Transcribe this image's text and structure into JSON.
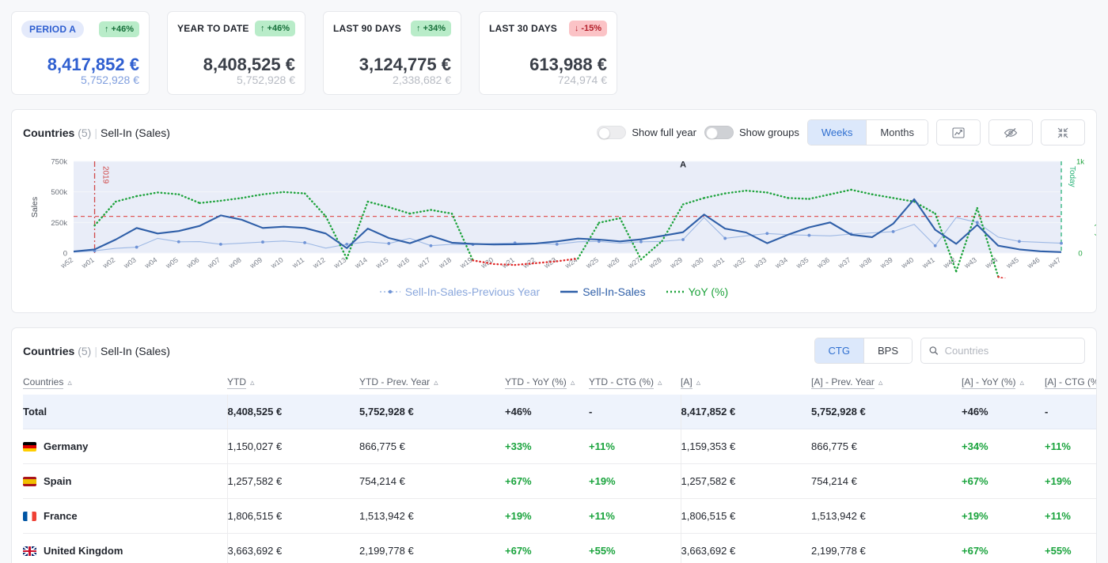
{
  "kpi_cards": [
    {
      "label": "PERIOD A",
      "accent": true,
      "delta": "+46%",
      "direction": "up",
      "value": "8,417,852 €",
      "prev": "5,752,928 €"
    },
    {
      "label": "YEAR TO DATE",
      "accent": false,
      "delta": "+46%",
      "direction": "up",
      "value": "8,408,525 €",
      "prev": "5,752,928 €"
    },
    {
      "label": "LAST 90 DAYS",
      "accent": false,
      "delta": "+34%",
      "direction": "up",
      "value": "3,124,775 €",
      "prev": "2,338,682 €"
    },
    {
      "label": "LAST 30 DAYS",
      "accent": false,
      "delta": "-15%",
      "direction": "down",
      "value": "613,988 €",
      "prev": "724,974 €"
    }
  ],
  "chart_panel": {
    "title_main": "Countries",
    "title_count": "(5)",
    "title_sub": "Sell-In (Sales)",
    "toggles": [
      {
        "label": "Show full year",
        "on": false,
        "dim": false
      },
      {
        "label": "Show groups",
        "on": false,
        "dim": true
      }
    ],
    "granularity": {
      "options": [
        "Weeks",
        "Months"
      ],
      "selected": "Weeks"
    },
    "icon_buttons": [
      "trend-chart-icon",
      "eye-off-icon",
      "collapse-icon"
    ],
    "legend": [
      {
        "name": "Sell-In-Sales-Previous Year",
        "color": "#8aa7dc",
        "style": "dotted-marker"
      },
      {
        "name": "Sell-In-Sales",
        "color": "#2f5fa8",
        "style": "solid"
      },
      {
        "name": "YoY (%)",
        "color": "#1ea33c",
        "style": "dotted"
      }
    ]
  },
  "chart_data": {
    "type": "line",
    "title": "Countries (5) | Sell-In (Sales)",
    "xlabel": "",
    "ylabel": "Sales",
    "y2label": "YoY (%)",
    "ylim": [
      0,
      750000
    ],
    "yticks": [
      0,
      250000,
      500000,
      750000
    ],
    "ytick_labels": [
      "0",
      "250k",
      "500k",
      "750k"
    ],
    "y2lim": [
      0,
      1000
    ],
    "y2ticks": [
      0,
      1000
    ],
    "y2tick_labels": [
      "0",
      "1k"
    ],
    "grid": true,
    "legend_position": "bottom-center",
    "annotations": [
      {
        "text": "2019",
        "type": "vline",
        "x": "w01",
        "color": "#d04a4a",
        "style": "dash-dot"
      },
      {
        "text": "Today",
        "type": "vline",
        "x": "w47",
        "color": "#2cb47a",
        "style": "dashed"
      },
      {
        "text": "A",
        "type": "label",
        "x": "w29",
        "y": 700000,
        "color": "#22262e"
      },
      {
        "text": "",
        "type": "hline",
        "y": 300000,
        "color": "#e05a5a",
        "style": "dashed"
      }
    ],
    "x": [
      "w52",
      "w01",
      "w02",
      "w03",
      "w04",
      "w05",
      "w06",
      "w07",
      "w08",
      "w09",
      "w10",
      "w11",
      "w12",
      "w13",
      "w14",
      "w15",
      "w16",
      "w17",
      "w18",
      "w19",
      "w20",
      "w21",
      "w22",
      "w23",
      "w24",
      "w25",
      "w26",
      "w27",
      "w28",
      "w29",
      "w30",
      "w31",
      "w32",
      "w33",
      "w34",
      "w35",
      "w36",
      "w37",
      "w38",
      "w39",
      "w40",
      "w41",
      "w42",
      "w43",
      "w44",
      "w45",
      "w46",
      "w47"
    ],
    "series": [
      {
        "name": "Sell-In-Sales",
        "color": "#2f5fa8",
        "axis": "left",
        "values": [
          12000,
          30000,
          110000,
          205000,
          160000,
          180000,
          222000,
          308000,
          272000,
          205000,
          215000,
          205000,
          160000,
          40000,
          200000,
          123000,
          80000,
          140000,
          85000,
          75000,
          70000,
          72000,
          78000,
          95000,
          118000,
          110000,
          95000,
          112000,
          140000,
          170000,
          315000,
          200000,
          168000,
          80000,
          150000,
          210000,
          250000,
          150000,
          130000,
          240000,
          440000,
          190000,
          75000,
          230000,
          60000,
          30000,
          14000,
          8000
        ]
      },
      {
        "name": "Sell-In-Sales-Previous Year",
        "color": "#9db8e4",
        "axis": "left",
        "values": [
          8000,
          18000,
          38000,
          48000,
          120000,
          92000,
          93000,
          72000,
          80000,
          90000,
          98000,
          85000,
          40000,
          72000,
          92000,
          78000,
          120000,
          60000,
          72000,
          70000,
          78000,
          82000,
          80000,
          72000,
          92000,
          95000,
          80000,
          92000,
          95000,
          110000,
          290000,
          120000,
          140000,
          160000,
          150000,
          145000,
          140000,
          155000,
          165000,
          175000,
          235000,
          60000,
          290000,
          250000,
          130000,
          95000,
          88000,
          80000
        ]
      },
      {
        "name": "YoY (%)",
        "color": "#1ea33c",
        "negative_color": "#e02b2b",
        "axis": "right",
        "values": [
          null,
          300,
          560,
          620,
          660,
          640,
          545,
          570,
          600,
          640,
          665,
          650,
          400,
          -60,
          560,
          500,
          430,
          470,
          430,
          -80,
          -120,
          -130,
          -110,
          -90,
          -60,
          330,
          380,
          -70,
          130,
          530,
          600,
          650,
          680,
          660,
          600,
          590,
          640,
          690,
          640,
          600,
          560,
          430,
          -200,
          490,
          -260,
          -330,
          -340,
          -340
        ]
      }
    ]
  },
  "table_panel": {
    "title_main": "Countries",
    "title_count": "(5)",
    "title_sub": "Sell-In (Sales)",
    "unit_toggle": {
      "options": [
        "CTG",
        "BPS"
      ],
      "selected": "CTG"
    },
    "search": {
      "placeholder": "Countries",
      "value": ""
    },
    "columns": [
      "Countries",
      "YTD",
      "YTD - Prev. Year",
      "YTD - YoY (%)",
      "YTD - CTG (%)",
      "[A]",
      "[A] - Prev. Year",
      "[A] - YoY (%)",
      "[A] - CTG (%)"
    ],
    "total_row": {
      "label": "Total",
      "ytd": "8,408,525 €",
      "ytd_prev": "5,752,928 €",
      "ytd_yoy": "+46%",
      "ytd_ctg": "-",
      "a": "8,417,852 €",
      "a_prev": "5,752,928 €",
      "a_yoy": "+46%",
      "a_ctg": "-"
    },
    "rows": [
      {
        "country": "Germany",
        "flag": "de",
        "ytd": "1,150,027 €",
        "ytd_prev": "866,775 €",
        "ytd_yoy": "+33%",
        "ytd_ctg": "+11%",
        "a": "1,159,353 €",
        "a_prev": "866,775 €",
        "a_yoy": "+34%",
        "a_ctg": "+11%"
      },
      {
        "country": "Spain",
        "flag": "es",
        "ytd": "1,257,582 €",
        "ytd_prev": "754,214 €",
        "ytd_yoy": "+67%",
        "ytd_ctg": "+19%",
        "a": "1,257,582 €",
        "a_prev": "754,214 €",
        "a_yoy": "+67%",
        "a_ctg": "+19%"
      },
      {
        "country": "France",
        "flag": "fr",
        "ytd": "1,806,515 €",
        "ytd_prev": "1,513,942 €",
        "ytd_yoy": "+19%",
        "ytd_ctg": "+11%",
        "a": "1,806,515 €",
        "a_prev": "1,513,942 €",
        "a_yoy": "+19%",
        "a_ctg": "+11%"
      },
      {
        "country": "United Kingdom",
        "flag": "gb",
        "ytd": "3,663,692 €",
        "ytd_prev": "2,199,778 €",
        "ytd_yoy": "+67%",
        "ytd_ctg": "+55%",
        "a": "3,663,692 €",
        "a_prev": "2,199,778 €",
        "a_yoy": "+67%",
        "a_ctg": "+55%"
      }
    ]
  }
}
